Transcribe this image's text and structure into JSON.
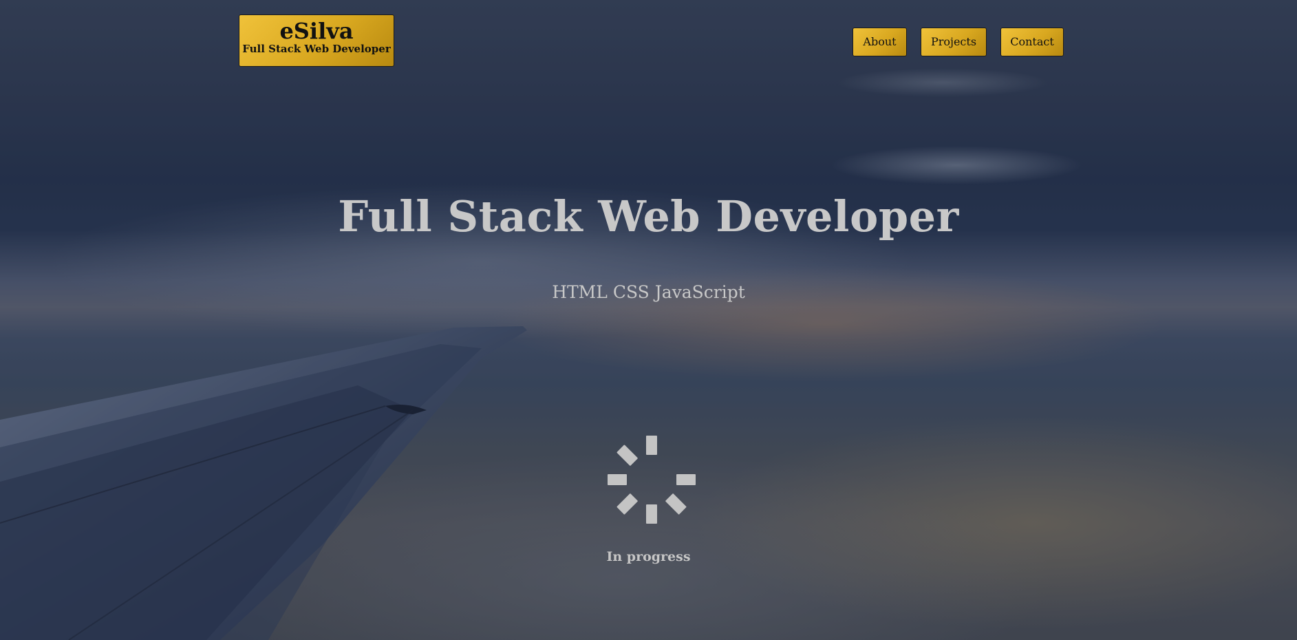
{
  "header": {
    "brand_name": "eSilva",
    "brand_tagline": "Full Stack Web Developer",
    "nav": [
      {
        "label": "About"
      },
      {
        "label": "Projects"
      },
      {
        "label": "Contact"
      }
    ]
  },
  "hero": {
    "title": "Full Stack Web Developer",
    "subtitle": "HTML CSS JavaScript",
    "status": "In progress"
  },
  "colors": {
    "accent": "#e0b02a",
    "hero_text": "#c8c8c8"
  },
  "icons": {
    "spinner": "loading-spinner-icon"
  }
}
